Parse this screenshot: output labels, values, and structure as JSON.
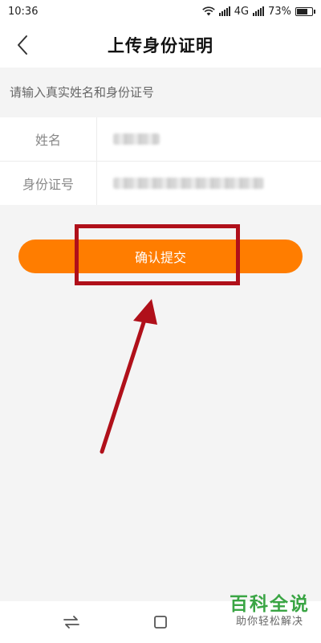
{
  "status_bar": {
    "time": "10:36",
    "network": "4G",
    "battery_percent": "73%",
    "battery_level": 0.73
  },
  "header": {
    "title": "上传身份证明",
    "back_icon": "chevron-left-icon"
  },
  "form": {
    "hint": "请输入真实姓名和身份证号",
    "fields": [
      {
        "label": "姓名"
      },
      {
        "label": "身份证号"
      }
    ]
  },
  "submit": {
    "label": "确认提交"
  },
  "annotation": {
    "color": "#b0101a"
  },
  "nav": {
    "icons": [
      "switch-arrows-icon",
      "square-icon"
    ]
  },
  "watermark": {
    "main": "百科全说",
    "sub": "助你轻松解决"
  },
  "colors": {
    "accent": "#ff7d00",
    "background": "#f4f4f4",
    "watermark": "#3aa544"
  }
}
